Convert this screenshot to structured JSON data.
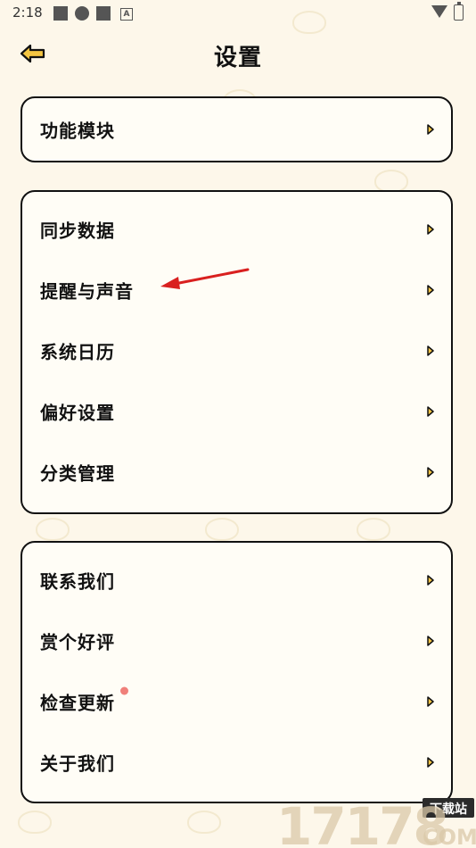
{
  "status_bar": {
    "time": "2:18",
    "badge": "A"
  },
  "header": {
    "title": "设置",
    "back_icon": "back-arrow-icon"
  },
  "colors": {
    "background": "#fdf7ea",
    "card_border": "#111111",
    "badge_dot": "#f0807a",
    "annotation_arrow": "#d9201f"
  },
  "cards": [
    {
      "items": [
        {
          "label": "功能模块"
        }
      ]
    },
    {
      "items": [
        {
          "label": "同步数据"
        },
        {
          "label": "提醒与声音"
        },
        {
          "label": "系统日历"
        },
        {
          "label": "偏好设置"
        },
        {
          "label": "分类管理"
        }
      ]
    },
    {
      "items": [
        {
          "label": "联系我们"
        },
        {
          "label": "赏个好评"
        },
        {
          "label": "检查更新",
          "has_dot": true
        },
        {
          "label": "关于我们"
        }
      ]
    }
  ],
  "watermark": {
    "digits": "17178",
    "tag": "下载站",
    "suffix": "COM"
  }
}
